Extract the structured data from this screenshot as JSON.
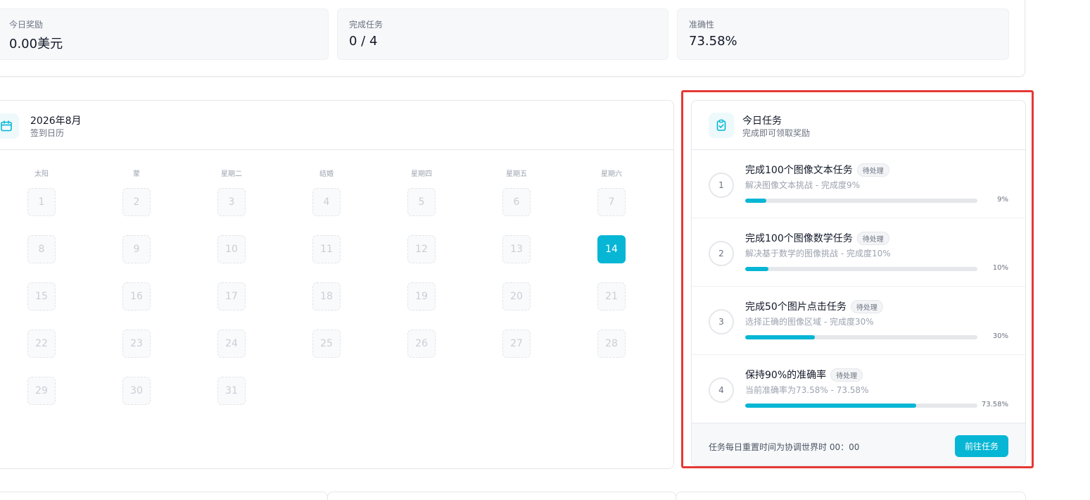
{
  "stats": [
    {
      "label": "今日奖励",
      "value": "0.00美元"
    },
    {
      "label": "完成任务",
      "value": "0 / 4"
    },
    {
      "label": "准确性",
      "value": "73.58%"
    }
  ],
  "calendar": {
    "title": "2026年8月",
    "subtitle": "签到日历",
    "weekdays": [
      "太阳",
      "蒙",
      "星期二",
      "结婚",
      "星期四",
      "星期五",
      "星期六"
    ],
    "days": [
      "1",
      "2",
      "3",
      "4",
      "5",
      "6",
      "7",
      "8",
      "9",
      "10",
      "11",
      "12",
      "13",
      "14",
      "15",
      "16",
      "17",
      "18",
      "19",
      "20",
      "21",
      "22",
      "23",
      "24",
      "25",
      "26",
      "27",
      "28",
      "29",
      "30",
      "31"
    ],
    "today": "14"
  },
  "tasks": {
    "title": "今日任务",
    "subtitle": "完成即可领取奖励",
    "items": [
      {
        "num": "1",
        "name": "完成100个图像文本任务",
        "badge": "待处理",
        "desc": "解决图像文本挑战 - 完成度9%",
        "progress": 0.09,
        "pct": "9%"
      },
      {
        "num": "2",
        "name": "完成100个图像数学任务",
        "badge": "待处理",
        "desc": "解决基于数学的图像挑战 - 完成度10%",
        "progress": 0.1,
        "pct": "10%"
      },
      {
        "num": "3",
        "name": "完成50个图片点击任务",
        "badge": "待处理",
        "desc": "选择正确的图像区域 - 完成度30%",
        "progress": 0.3,
        "pct": "30%"
      },
      {
        "num": "4",
        "name": "保持90%的准确率",
        "badge": "待处理",
        "desc": "当前准确率为73.58% - 73.58%",
        "progress": 0.7358,
        "pct": "73.58%"
      }
    ],
    "footer_text": "任务每日重置时间为协调世界时 00：00",
    "button_label": "前往任务"
  },
  "colors": {
    "accent": "#06b6d4",
    "highlight": "#e53935"
  }
}
